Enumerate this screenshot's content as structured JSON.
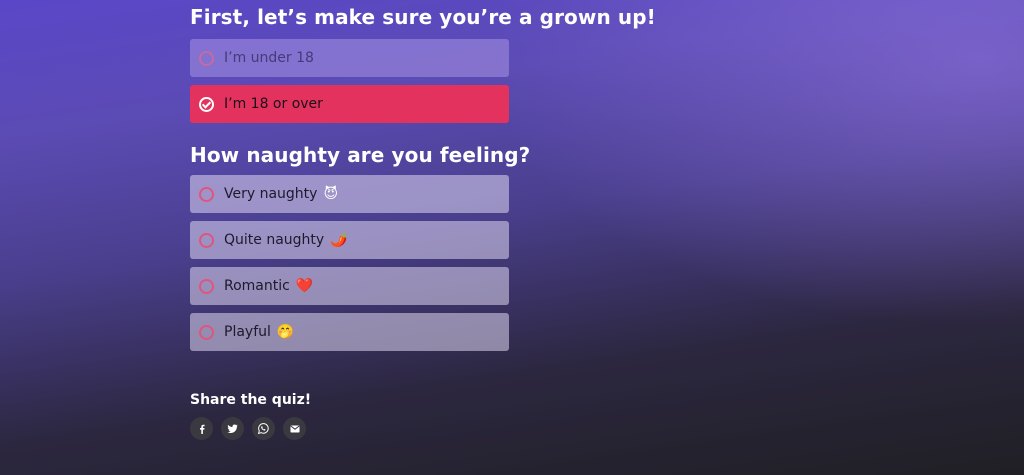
{
  "question1": {
    "title": "First, let’s make sure you’re a grown up!",
    "options": [
      {
        "label": "I’m under 18",
        "selected": false
      },
      {
        "label": "I’m 18 or over",
        "selected": true
      }
    ]
  },
  "question2": {
    "title": "How naughty are you feeling?",
    "options": [
      {
        "label": "Very naughty",
        "emoji": "😈",
        "emoji_name": "smiling-devil-icon"
      },
      {
        "label": "Quite naughty",
        "emoji": "🌶️",
        "emoji_name": "chili-pepper-icon"
      },
      {
        "label": "Romantic",
        "emoji": "❤️",
        "emoji_name": "red-heart-icon"
      },
      {
        "label": "Playful",
        "emoji": "🤭",
        "emoji_name": "giggling-face-icon"
      }
    ]
  },
  "share": {
    "title": "Share the quiz!",
    "buttons": [
      {
        "icon": "facebook-icon"
      },
      {
        "icon": "twitter-icon"
      },
      {
        "icon": "whatsapp-icon"
      },
      {
        "icon": "email-icon"
      }
    ]
  },
  "colors": {
    "selected_option": "#e4325e",
    "radio_ring": "#e0557c",
    "share_button_bg": "#3a3940"
  }
}
